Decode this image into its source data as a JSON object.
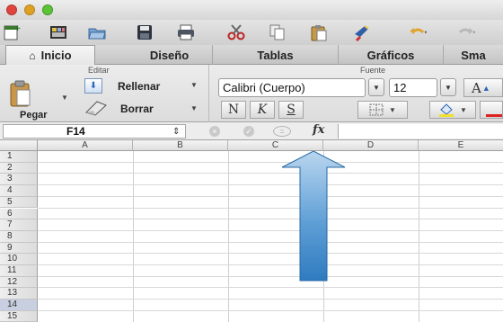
{
  "window": {
    "title": ""
  },
  "toolbar": {
    "icons": [
      "new-workbook-icon",
      "templates-icon",
      "open-icon",
      "save-icon",
      "print-icon",
      "cut-icon",
      "copy-icon",
      "paste-icon",
      "format-painter-icon",
      "undo-icon",
      "redo-icon"
    ]
  },
  "tabs": [
    {
      "label": "Inicio",
      "active": true
    },
    {
      "label": "Diseño",
      "active": false
    },
    {
      "label": "Tablas",
      "active": false
    },
    {
      "label": "Gráficos",
      "active": false
    },
    {
      "label": "Sma",
      "active": false
    }
  ],
  "ribbon": {
    "editar": {
      "title": "Editar",
      "paste_label": "Pegar",
      "fill_label": "Rellenar",
      "clear_label": "Borrar"
    },
    "fuente": {
      "title": "Fuente",
      "font_name": "Calibri (Cuerpo)",
      "font_size": "12",
      "bold_label": "N",
      "italic_label": "K",
      "underline_label": "S",
      "grow_label": "A"
    }
  },
  "formula_bar": {
    "name_box": "F14",
    "fx_label": "fx",
    "formula": ""
  },
  "sheet": {
    "columns": [
      "A",
      "B",
      "C",
      "D",
      "E"
    ],
    "rows": [
      "1",
      "2",
      "3",
      "4",
      "5",
      "6",
      "7",
      "8",
      "9",
      "10",
      "11",
      "12",
      "13",
      "14",
      "15"
    ],
    "selected_row": "14"
  },
  "colors": {
    "arrow": "#3c86c6",
    "selected_row": "#c7cfe0"
  }
}
